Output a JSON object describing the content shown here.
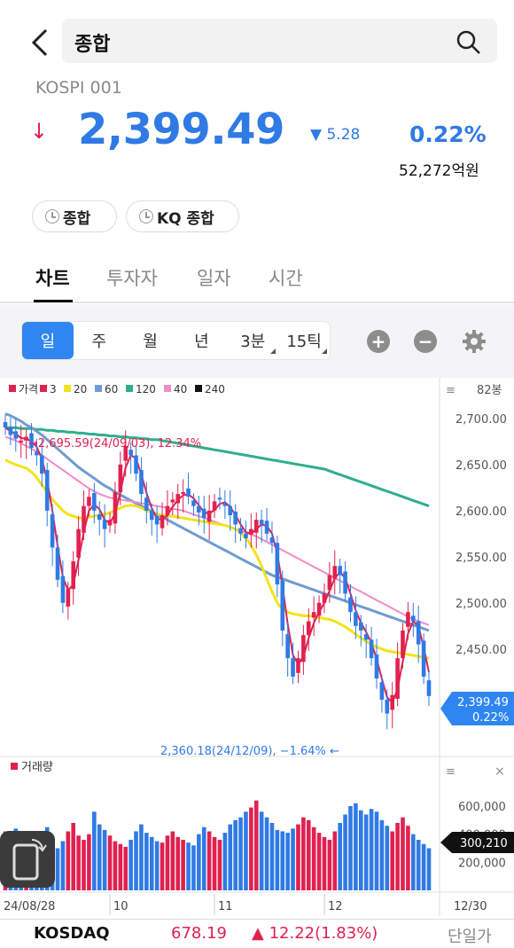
{
  "header": {
    "search_text": "종합"
  },
  "index": {
    "code": "KOSPI 001",
    "price": "2,399.49",
    "change": "5.28",
    "change_pct": "0.22%",
    "amount": "52,272억원",
    "down_arrow": "↓",
    "change_arrow": "▼"
  },
  "pills": [
    "종합",
    "KQ 종합"
  ],
  "tabs": [
    "차트",
    "투자자",
    "일자",
    "시간"
  ],
  "periods": [
    "일",
    "주",
    "월",
    "년",
    "3분",
    "15틱"
  ],
  "colors": {
    "up": "#e0214f",
    "down": "#2f7ae5",
    "ma3": "#e0214f",
    "ma20": "#f5e21a",
    "ma60": "#6f9ccf",
    "ma120": "#2fae8e",
    "ma40": "#f08cc8",
    "ma240": "#111111"
  },
  "chart_data": {
    "type": "line",
    "legend": [
      {
        "label": "가격",
        "color": "#e0214f"
      },
      {
        "label": "3",
        "color": "#e0214f"
      },
      {
        "label": "20",
        "color": "#f5e21a"
      },
      {
        "label": "60",
        "color": "#6f9ccf"
      },
      {
        "label": "120",
        "color": "#2fae8e"
      },
      {
        "label": "40",
        "color": "#f08cc8"
      },
      {
        "label": "240",
        "color": "#111111"
      }
    ],
    "bars_label": "82봉",
    "y_ticks": [
      "2,700.00",
      "2,650.00",
      "2,600.00",
      "2,550.00",
      "2,500.00",
      "2,450.00"
    ],
    "ylim": [
      2345,
      2720
    ],
    "x_ticks": [
      "24/08/28",
      "10",
      "11",
      "12",
      "12/30"
    ],
    "high_annotation": "2,695.59(24/09/03), 12.34%",
    "low_annotation": "2,360.18(24/12/09), −1.64%",
    "current_price": "2,399.49",
    "current_pct": "0.22%",
    "closes": [
      2690,
      2682,
      2678,
      2676,
      2680,
      2668,
      2660,
      2640,
      2600,
      2560,
      2525,
      2500,
      2515,
      2545,
      2580,
      2605,
      2615,
      2600,
      2590,
      2580,
      2590,
      2620,
      2650,
      2670,
      2660,
      2640,
      2618,
      2600,
      2590,
      2585,
      2595,
      2605,
      2612,
      2618,
      2620,
      2615,
      2605,
      2598,
      2592,
      2600,
      2610,
      2612,
      2605,
      2595,
      2585,
      2575,
      2570,
      2580,
      2590,
      2585,
      2575,
      2565,
      2520,
      2470,
      2440,
      2420,
      2440,
      2465,
      2480,
      2490,
      2500,
      2510,
      2530,
      2540,
      2530,
      2510,
      2490,
      2475,
      2470,
      2460,
      2440,
      2418,
      2395,
      2380,
      2400,
      2440,
      2470,
      2490,
      2480,
      2455,
      2420,
      2399
    ],
    "volume": {
      "label": "거래량",
      "ticks": [
        "600,000",
        "400,000",
        "200,000"
      ],
      "current": "300,210",
      "values": [
        420000,
        380000,
        440000,
        300000,
        360000,
        390000,
        320000,
        410000,
        450000,
        380000,
        300000,
        350000,
        420000,
        480000,
        390000,
        360000,
        400000,
        560000,
        470000,
        430000,
        390000,
        350000,
        330000,
        310000,
        360000,
        420000,
        470000,
        410000,
        380000,
        350000,
        340000,
        390000,
        420000,
        380000,
        360000,
        340000,
        320000,
        400000,
        450000,
        420000,
        380000,
        360000,
        410000,
        470000,
        500000,
        520000,
        560000,
        590000,
        640000,
        560000,
        520000,
        480000,
        430000,
        420000,
        410000,
        440000,
        470000,
        520000,
        500000,
        450000,
        410000,
        380000,
        360000,
        420000,
        480000,
        540000,
        600000,
        620000,
        570000,
        540000,
        580000,
        560000,
        500000,
        460000,
        420000,
        480000,
        520000,
        460000,
        400000,
        360000,
        330000,
        300210
      ]
    },
    "ma": {
      "ma20": [
        2655,
        2652,
        2650,
        2648,
        2646,
        2642,
        2636,
        2628,
        2620,
        2612,
        2606,
        2600,
        2596,
        2594,
        2592,
        2592,
        2593,
        2594,
        2595,
        2596,
        2598,
        2600,
        2603,
        2605,
        2606,
        2605,
        2603,
        2600,
        2598,
        2596,
        2595,
        2594,
        2594,
        2593,
        2592,
        2591,
        2590,
        2589,
        2588,
        2587,
        2586,
        2585,
        2584,
        2582,
        2580,
        2576,
        2570,
        2562,
        2552,
        2540,
        2526,
        2512,
        2500,
        2493,
        2490,
        2488,
        2487,
        2486,
        2486,
        2485,
        2484,
        2483,
        2482,
        2480,
        2477,
        2474,
        2470,
        2466,
        2462,
        2458,
        2455,
        2452,
        2450,
        2448,
        2447,
        2446,
        2445,
        2444,
        2443,
        2442,
        2441,
        2440
      ],
      "ma60": [
        2705,
        2703,
        2700,
        2697,
        2693,
        2690,
        2686,
        2682,
        2677,
        2672,
        2667,
        2662,
        2657,
        2652,
        2647,
        2643,
        2639,
        2635,
        2631,
        2627,
        2624,
        2620,
        2617,
        2614,
        2611,
        2608,
        2605,
        2602,
        2599,
        2596,
        2593,
        2590,
        2587,
        2584,
        2581,
        2578,
        2575,
        2572,
        2569,
        2566,
        2563,
        2560,
        2557,
        2554,
        2551,
        2548,
        2545,
        2542,
        2539,
        2536,
        2533,
        2530,
        2528,
        2526,
        2524,
        2522,
        2520,
        2518,
        2516,
        2514,
        2512,
        2510,
        2508,
        2506,
        2504,
        2502,
        2500,
        2498,
        2496,
        2494,
        2492,
        2490,
        2488,
        2486,
        2484,
        2482,
        2480,
        2478,
        2476,
        2474,
        2472,
        2470
      ],
      "ma120": [
        2690,
        2690,
        2690,
        2689,
        2689,
        2689,
        2688,
        2688,
        2687,
        2687,
        2686,
        2686,
        2685,
        2685,
        2684,
        2684,
        2683,
        2683,
        2682,
        2682,
        2681,
        2681,
        2680,
        2680,
        2679,
        2679,
        2678,
        2678,
        2677,
        2677,
        2676,
        2675,
        2674,
        2673,
        2672,
        2671,
        2670,
        2669,
        2668,
        2667,
        2666,
        2665,
        2664,
        2663,
        2662,
        2661,
        2660,
        2659,
        2658,
        2657,
        2656,
        2655,
        2654,
        2653,
        2652,
        2651,
        2650,
        2649,
        2648,
        2647,
        2646,
        2645,
        2643,
        2641,
        2639,
        2637,
        2635,
        2633,
        2631,
        2629,
        2627,
        2625,
        2623,
        2621,
        2619,
        2617,
        2615,
        2613,
        2611,
        2609,
        2607,
        2605
      ],
      "ma40": [
        2680,
        2678,
        2676,
        2673,
        2670,
        2667,
        2664,
        2660,
        2656,
        2652,
        2648,
        2644,
        2640,
        2636,
        2632,
        2628,
        2624,
        2621,
        2618,
        2616,
        2614,
        2613,
        2612,
        2611,
        2610,
        2609,
        2608,
        2607,
        2606,
        2605,
        2604,
        2603,
        2602,
        2601,
        2600,
        2598,
        2596,
        2594,
        2592,
        2590,
        2588,
        2586,
        2584,
        2582,
        2580,
        2578,
        2576,
        2574,
        2572,
        2569,
        2566,
        2563,
        2560,
        2557,
        2554,
        2551,
        2548,
        2545,
        2542,
        2539,
        2536,
        2533,
        2530,
        2527,
        2524,
        2521,
        2518,
        2515,
        2512,
        2509,
        2506,
        2503,
        2500,
        2497,
        2494,
        2491,
        2488,
        2485,
        2482,
        2480,
        2478,
        2476
      ]
    }
  },
  "footer": {
    "name": "KOSDAQ",
    "value": "678.19",
    "change": "▲ 12.22(1.83%)",
    "link": "단일가"
  }
}
